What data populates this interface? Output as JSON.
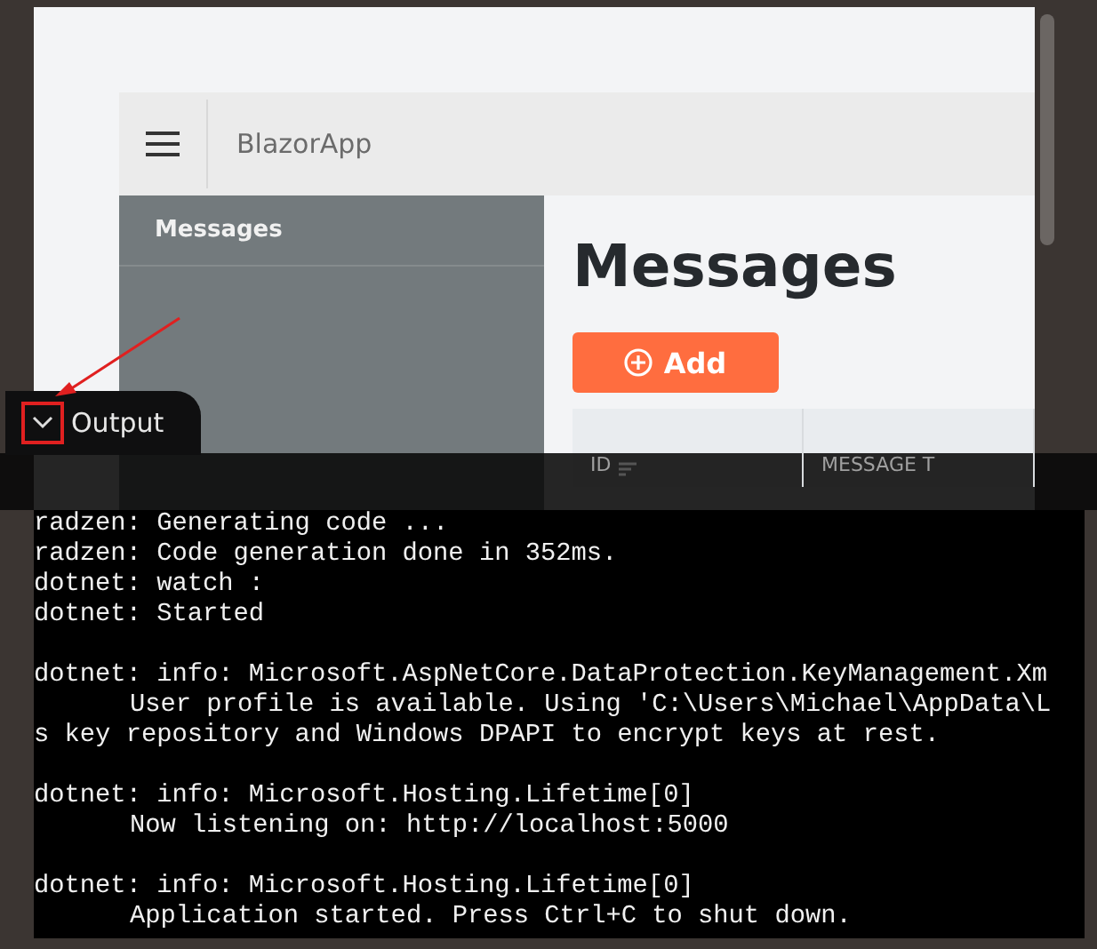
{
  "app": {
    "title": "BlazorApp"
  },
  "sidebar": {
    "items": [
      {
        "label": "Messages",
        "selected": true
      }
    ]
  },
  "page": {
    "heading": "Messages",
    "add_button": "Add"
  },
  "table": {
    "columns": [
      "ID",
      "MESSAGE T"
    ]
  },
  "output_panel": {
    "tab": "Output",
    "expanded": true,
    "lines": [
      {
        "kind": "line",
        "text": "radzen: Generating code ..."
      },
      {
        "kind": "line",
        "text": "radzen: Code generation done in 352ms."
      },
      {
        "kind": "line",
        "text": "dotnet: watch :"
      },
      {
        "kind": "line",
        "text": "dotnet: Started"
      },
      {
        "kind": "blank"
      },
      {
        "kind": "line",
        "text": "dotnet: info: Microsoft.AspNetCore.DataProtection.KeyManagement.Xm"
      },
      {
        "kind": "indented",
        "text": "User profile is available. Using 'C:\\Users\\Michael\\AppData\\L"
      },
      {
        "kind": "line",
        "text": "s key repository and Windows DPAPI to encrypt keys at rest."
      },
      {
        "kind": "blank"
      },
      {
        "kind": "line",
        "text": "dotnet: info: Microsoft.Hosting.Lifetime[0]"
      },
      {
        "kind": "indented",
        "text": "Now listening on: http://localhost:5000"
      },
      {
        "kind": "blank"
      },
      {
        "kind": "line",
        "text": "dotnet: info: Microsoft.Hosting.Lifetime[0]"
      },
      {
        "kind": "indented",
        "text": "Application started. Press Ctrl+C to shut down."
      }
    ]
  }
}
